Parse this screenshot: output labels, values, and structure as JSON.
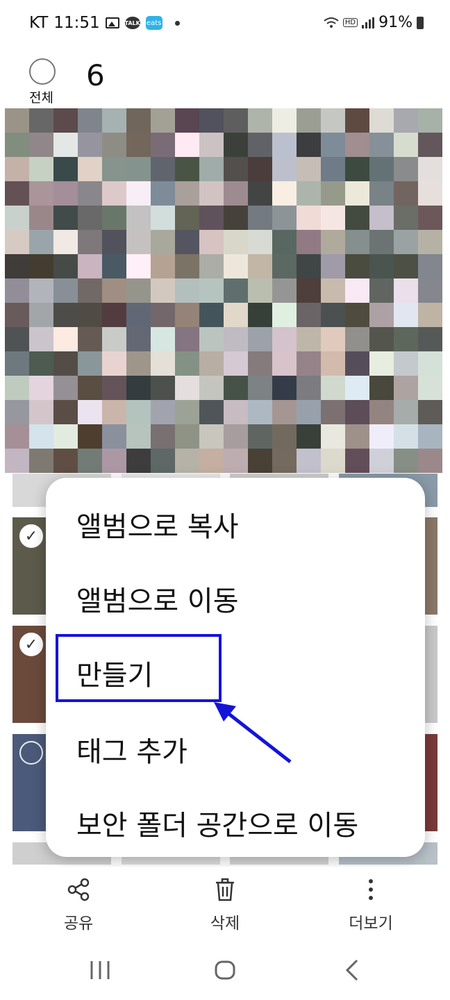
{
  "status_bar": {
    "carrier": "KT",
    "time": "11:51",
    "battery": "91%",
    "notifications": [
      "image-icon",
      "kakaotalk-icon",
      "eats-icon"
    ],
    "talk_label": "TALK",
    "eats_label": "eats",
    "hd_label": "HD"
  },
  "header": {
    "select_all_label": "전체",
    "selected_count": "6"
  },
  "context_menu": {
    "items": [
      "앨범으로 복사",
      "앨범으로 이동",
      "만들기",
      "태그 추가",
      "보안 폴더 공간으로 이동"
    ],
    "highlighted_item": "만들기"
  },
  "bottom_actions": {
    "share": "공유",
    "delete": "삭제",
    "more": "더보기"
  },
  "colors": {
    "highlight_box": "#1414d8",
    "arrow": "#1414d8"
  }
}
